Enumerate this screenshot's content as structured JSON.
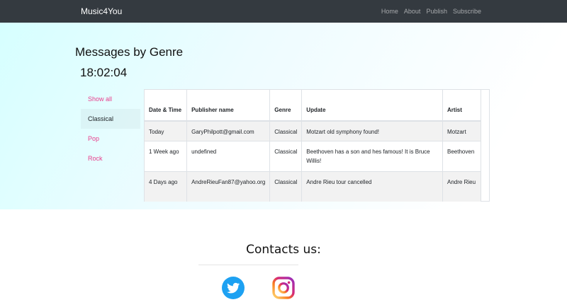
{
  "navbar": {
    "brand": "Music4You",
    "links": [
      "Home",
      "About",
      "Publish",
      "Subscribe"
    ]
  },
  "main": {
    "title": "Messages by Genre",
    "clock": "18:02:04"
  },
  "genres": [
    {
      "label": "Show all",
      "active": false
    },
    {
      "label": "Classical",
      "active": true
    },
    {
      "label": "Pop",
      "active": false
    },
    {
      "label": "Rock",
      "active": false
    }
  ],
  "table": {
    "headers": [
      "Date & Time",
      "Publisher name",
      "Genre",
      "Update",
      "Artist"
    ],
    "rows": [
      [
        "Today",
        "GaryPhilpott@gmail.com",
        "Classical",
        "Motzart old symphony found!",
        "Motzart"
      ],
      [
        "1 Week ago",
        "undefined",
        "Classical",
        "Beethoven has a son and hes famous! It is Bruce Willis!",
        "Beethoven"
      ],
      [
        "4 Days ago",
        "AndreRieuFan87@yahoo.org",
        "Classical",
        "Andre Rieu tour cancelled",
        "Andre Rieu"
      ]
    ]
  },
  "footer": {
    "contacts_title": "Contacts us:",
    "icons": [
      "twitter-icon",
      "instagram-icon"
    ]
  },
  "colors": {
    "navbar": "#343a40",
    "link_accent": "#e83e8c",
    "twitter": "#1da1f2"
  }
}
